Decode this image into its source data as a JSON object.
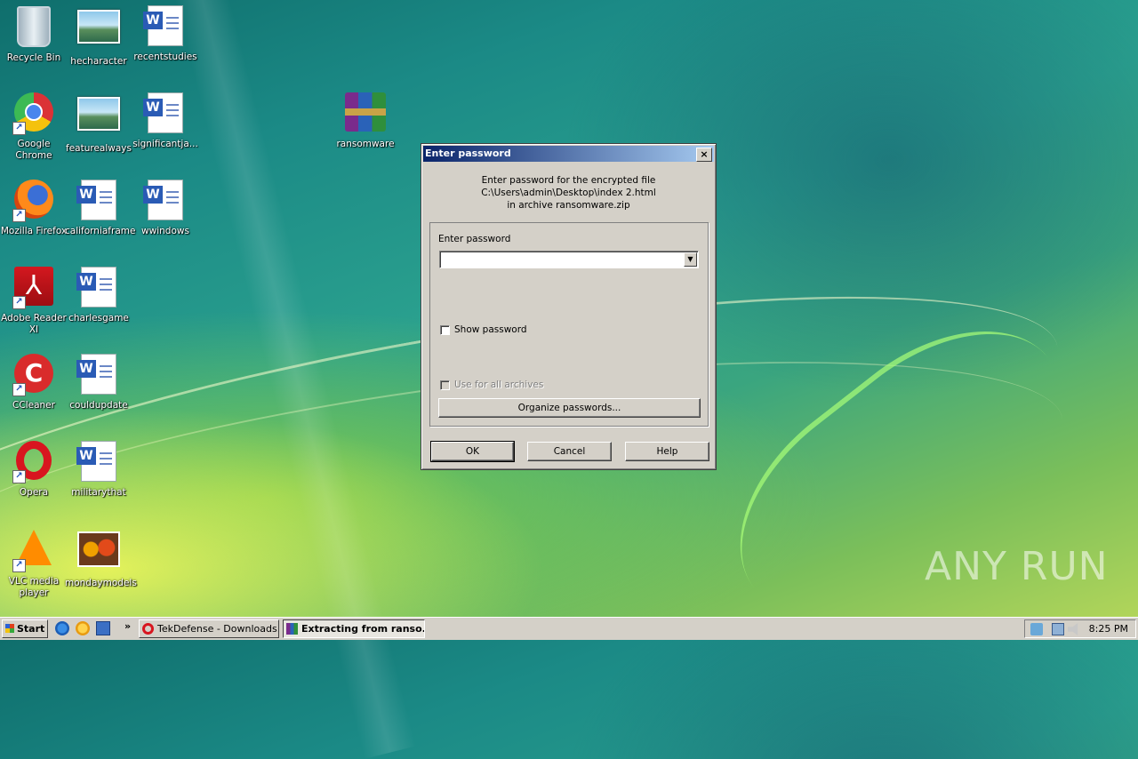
{
  "desktop": {
    "icons": [
      {
        "label": "Recycle Bin",
        "kind": "recycle-bin-icon"
      },
      {
        "label": "hecharacter",
        "kind": "image-file-icon"
      },
      {
        "label": "recentstudies",
        "kind": "word-document-icon"
      },
      {
        "label": "Google Chrome",
        "kind": "chrome-icon"
      },
      {
        "label": "featurealways",
        "kind": "image-file-icon"
      },
      {
        "label": "significantja...",
        "kind": "word-document-icon"
      },
      {
        "label": "ransomware",
        "kind": "winrar-archive-icon"
      },
      {
        "label": "Mozilla Firefox",
        "kind": "firefox-icon"
      },
      {
        "label": "californiaframe",
        "kind": "word-document-icon"
      },
      {
        "label": "wwindows",
        "kind": "word-document-icon"
      },
      {
        "label": "Adobe Reader XI",
        "kind": "adobe-reader-icon"
      },
      {
        "label": "charlesgame",
        "kind": "word-document-icon"
      },
      {
        "label": "CCleaner",
        "kind": "ccleaner-icon"
      },
      {
        "label": "couldupdate",
        "kind": "word-document-icon"
      },
      {
        "label": "Opera",
        "kind": "opera-icon"
      },
      {
        "label": "militarythat",
        "kind": "word-document-icon"
      },
      {
        "label": "VLC media player",
        "kind": "vlc-icon"
      },
      {
        "label": "mondaymodels",
        "kind": "image-file-icon"
      }
    ],
    "watermark": "ANY RUN"
  },
  "dialog": {
    "title": "Enter password",
    "close": "×",
    "prompt_line1": "Enter password for the encrypted file",
    "prompt_line2": "C:\\Users\\admin\\Desktop\\index 2.html",
    "prompt_line3": "in archive ransomware.zip",
    "password_label": "Enter password",
    "password_value": "",
    "show_password_label": "Show password",
    "use_for_all_label": "Use for all archives",
    "organize_label": "Organize passwords...",
    "ok_label": "OK",
    "cancel_label": "Cancel",
    "help_label": "Help"
  },
  "taskbar": {
    "start_label": "Start",
    "chevron": "»",
    "tasks": [
      {
        "label": "TekDefense - Downloads...",
        "active": false
      },
      {
        "label": "Extracting from ranso...",
        "active": true
      }
    ],
    "clock": "8:25 PM"
  }
}
